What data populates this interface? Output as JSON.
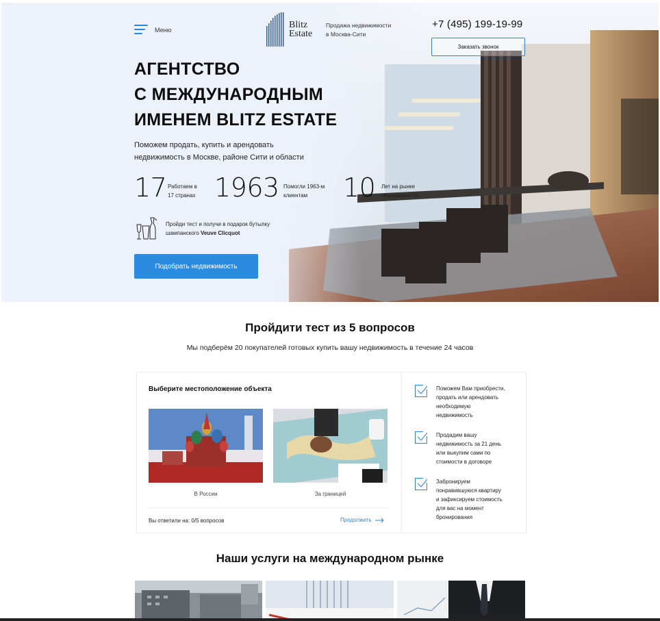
{
  "header": {
    "menu_label": "Меню",
    "logo_line1": "Blitz",
    "logo_line2": "Estate",
    "tagline_line1": "Продажа недвижимости",
    "tagline_line2": "в Москва-Сити",
    "phone": "+7 (495) 199-19-99",
    "callback_label": "Заказать звонок"
  },
  "hero": {
    "headline_line1": "АГЕНТСТВО",
    "headline_line2": "С МЕЖДУНАРОДНЫМ",
    "headline_line3": "ИМЕНЕМ BLITZ ESTATE",
    "subhead_line1": "Поможем продать, купить и арендовать",
    "subhead_line2": "недвижимость в Москве, районе Сити и области",
    "stats": [
      {
        "number": "17",
        "label_line1": "Работаем в",
        "label_line2": "17 странах"
      },
      {
        "number": "1963",
        "label_line1": "Помогли 1963-м",
        "label_line2": "клиентам"
      },
      {
        "number": "10",
        "label_line1": "Лет на рынке",
        "label_line2": "недвижимости"
      }
    ],
    "gift_line1": "Пройди тест и получи в подарок бутылку",
    "gift_line2_prefix": "шампанского ",
    "gift_brand": "Veuve Clicquot",
    "cta_label": "Подобрать недвижимость"
  },
  "quiz": {
    "title": "Пройдити тест из 5 вопросов",
    "subtitle": "Мы подберём 20 покупателей готовых купить вашу недвижимость в течение 24 часов",
    "question": "Выберите местоположение объекта",
    "options": [
      {
        "label": "В России"
      },
      {
        "label": "За границей"
      }
    ],
    "answered": "Вы ответили на: 0/5 вопросов",
    "next_label": "Продолжить",
    "benefits": [
      {
        "lines": [
          "Поможем Вам приобрести,",
          "продать или арендовать",
          "необходимую",
          "недвижимость"
        ]
      },
      {
        "lines": [
          "Продадим вашу",
          "недвижимость за 21 день",
          "или выкупим сами по",
          "стоимости в договоре"
        ]
      },
      {
        "lines": [
          "Забронируем",
          "понравившуюся квартиру",
          "и зафиксируем стоимость",
          "для вас на момент",
          "бронирования"
        ]
      }
    ]
  },
  "services": {
    "title": "Наши услуги на международном рынке"
  },
  "colors": {
    "accent": "#2b8be0",
    "hero_bg": "#edf2fa",
    "text": "#111111"
  }
}
